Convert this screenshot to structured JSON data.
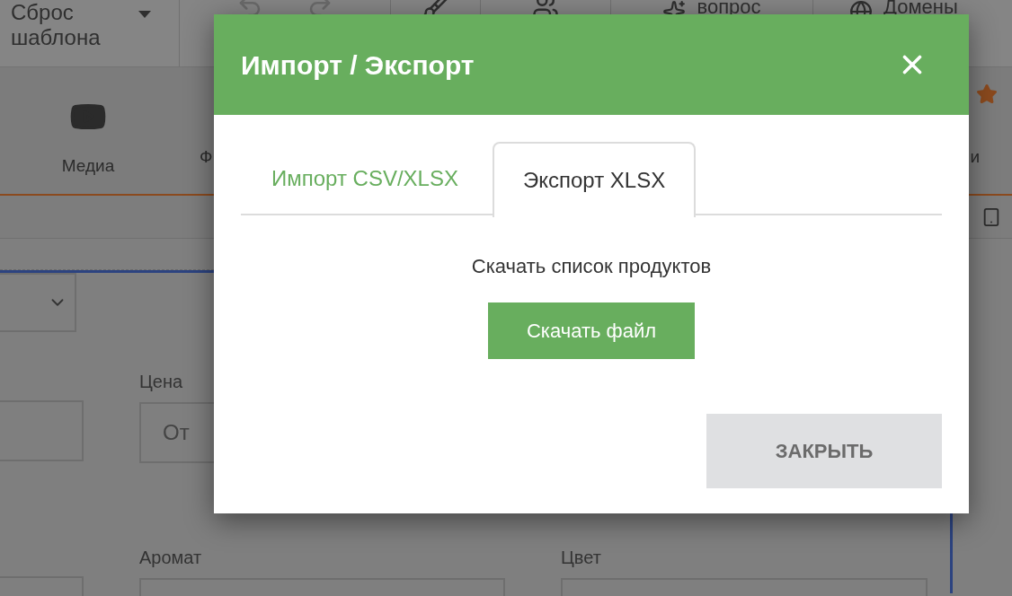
{
  "toolbar": [
    {
      "kind": "dropdown",
      "label": "Сброс шаблона"
    },
    {
      "kind": "history"
    },
    {
      "kind": "brush"
    },
    {
      "kind": "people"
    },
    {
      "kind": "sparkle",
      "label": "вопрос"
    },
    {
      "kind": "globe",
      "label": "Домены"
    }
  ],
  "ribbon": [
    {
      "kind": "video",
      "label": "Медиа"
    },
    {
      "kind": "text",
      "label": "Ф"
    },
    {
      "kind": "text",
      "label": "и"
    }
  ],
  "filters": [
    {
      "label": "Цена",
      "placeholder": "От"
    },
    {
      "label": "Аромат"
    },
    {
      "label": "Цвет"
    }
  ],
  "dialog": {
    "title": "Импорт / Экспорт",
    "tabs": [
      {
        "label": "Импорт CSV/XLSX",
        "selected": false
      },
      {
        "label": "Экспорт XLSX",
        "selected": true
      }
    ],
    "message": "Скачать список продуктов",
    "download_button": "Скачать файл",
    "close_button": "ЗАКРЫТЬ"
  }
}
